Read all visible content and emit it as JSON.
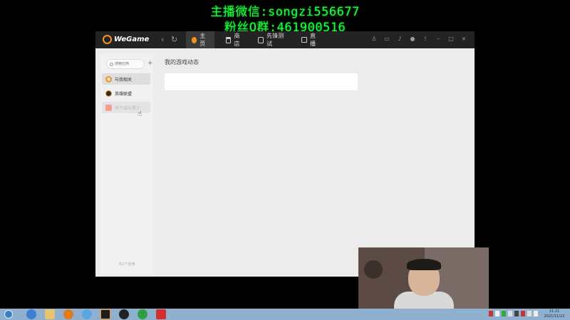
{
  "overlay": {
    "line1": "主播微信:songzi556677",
    "line2": "粉丝Q群:461900516"
  },
  "app": {
    "logo_text": "WeGame",
    "nav": {
      "back": "‹",
      "refresh": "↻"
    },
    "tabs": [
      {
        "label": "主页",
        "icon": "home-icon",
        "active": true
      },
      {
        "label": "商店",
        "icon": "shop-icon",
        "active": false
      },
      {
        "label": "先锋测试",
        "icon": "pioneer-icon",
        "active": false
      },
      {
        "label": "直播",
        "icon": "live-icon",
        "active": false
      }
    ],
    "window_controls": {
      "minimize": "–",
      "maximize": "□",
      "close": "×"
    }
  },
  "sidebar": {
    "search_placeholder": "搜索应用",
    "add_label": "+",
    "items": [
      {
        "label": "与我相关",
        "icon": "wegame-icon",
        "selected": true
      },
      {
        "label": "英雄联盟",
        "icon": "lol-icon",
        "selected": false
      },
      {
        "label": "地下城与勇士",
        "icon": "dnf-icon",
        "selected": false
      }
    ],
    "footer": "共2个应用"
  },
  "main": {
    "title": "我的游戏动态"
  },
  "taskbar": {
    "clock_time": "21:21",
    "clock_date": "2021/11/22"
  },
  "colors": {
    "accent": "#f6921e",
    "titlebar": "#232323",
    "overlay_text": "#1fff2f",
    "taskbar": "#8fb0cf"
  }
}
